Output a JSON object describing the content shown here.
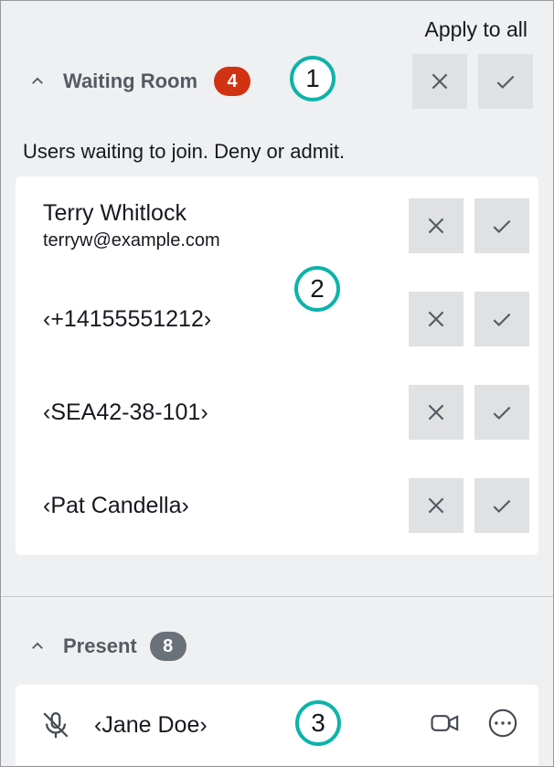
{
  "apply_all_label": "Apply to all",
  "waiting": {
    "title": "Waiting Room",
    "count": "4",
    "subtext": "Users waiting to join. Deny or admit.",
    "users": [
      {
        "name": "Terry Whitlock",
        "email": "terryw@example.com"
      },
      {
        "name": "‹+14155551212›"
      },
      {
        "name": "‹SEA42-38-101›"
      },
      {
        "name": "‹Pat Candella›"
      }
    ]
  },
  "present": {
    "title": "Present",
    "count": "8",
    "users": [
      {
        "name": "‹Jane Doe›"
      }
    ]
  },
  "callouts": {
    "c1": "1",
    "c2": "2",
    "c3": "3"
  }
}
